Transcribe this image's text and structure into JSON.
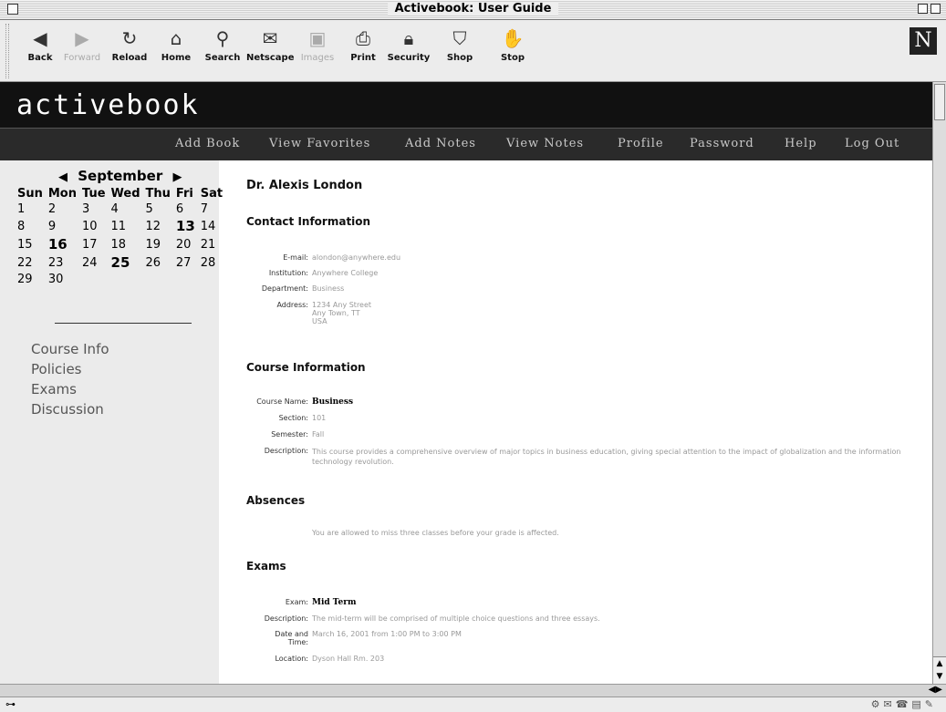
{
  "window": {
    "title": "Activebook: User Guide"
  },
  "toolbar": {
    "buttons": [
      {
        "label": "Back",
        "icon": "back-arrow-icon",
        "enabled": true
      },
      {
        "label": "Forward",
        "icon": "forward-arrow-icon",
        "enabled": false
      },
      {
        "label": "Reload",
        "icon": "reload-icon",
        "enabled": true
      },
      {
        "label": "Home",
        "icon": "home-icon",
        "enabled": true
      },
      {
        "label": "Search",
        "icon": "search-icon",
        "enabled": true
      },
      {
        "label": "Netscape",
        "icon": "netscape-icon",
        "enabled": true
      },
      {
        "label": "Images",
        "icon": "images-icon",
        "enabled": false
      },
      {
        "label": "Print",
        "icon": "print-icon",
        "enabled": true
      },
      {
        "label": "Security",
        "icon": "security-lock-icon",
        "enabled": true
      },
      {
        "label": "Shop",
        "icon": "shop-bag-icon",
        "enabled": true
      },
      {
        "label": "Stop",
        "icon": "stop-icon",
        "enabled": true
      }
    ],
    "logo_letter": "N"
  },
  "site": {
    "brand": "activebook",
    "nav": [
      "Add Book",
      "View Favorites",
      "Add Notes",
      "View Notes",
      "Profile",
      "Password",
      "Help",
      "Log Out"
    ]
  },
  "calendar": {
    "month": "September",
    "days_header": [
      "Sun",
      "Mon",
      "Tue",
      "Wed",
      "Thu",
      "Fri",
      "Sat"
    ],
    "weeks": [
      [
        "1",
        "2",
        "3",
        "4",
        "5",
        "6",
        "7"
      ],
      [
        "8",
        "9",
        "10",
        "11",
        "12",
        "13",
        "14"
      ],
      [
        "15",
        "16",
        "17",
        "18",
        "19",
        "20",
        "21"
      ],
      [
        "22",
        "23",
        "24",
        "25",
        "26",
        "27",
        "28"
      ],
      [
        "29",
        "30",
        "",
        "",
        "",
        "",
        ""
      ]
    ],
    "highlighted": [
      "13",
      "16",
      "25"
    ]
  },
  "sidebar": {
    "links": [
      "Course Info",
      "Policies",
      "Exams",
      "Discussion"
    ]
  },
  "main": {
    "name": "Dr. Alexis London",
    "contact": {
      "title": "Contact Information",
      "email_label": "E-mail:",
      "email": "alondon@anywhere.edu",
      "institution_label": "Institution:",
      "institution": "Anywhere College",
      "department_label": "Department:",
      "department": "Business",
      "address_label": "Address:",
      "address_line1": "1234 Any Street",
      "address_line2": "Any Town, TT",
      "address_line3": "USA"
    },
    "course": {
      "title": "Course Information",
      "name_label": "Course Name:",
      "name": "Business",
      "section_label": "Section:",
      "section": "101",
      "semester_label": "Semester:",
      "semester": "Fall",
      "description_label": "Description:",
      "description": "This course provides a comprehensive overview of major topics in business education, giving special attention to the impact of globalization and the information technology revolution."
    },
    "absences": {
      "title": "Absences",
      "text": "You are allowed to miss three classes before your grade is affected."
    },
    "exams": {
      "title": "Exams",
      "exam_label": "Exam:",
      "exam": "Mid Term",
      "description_label": "Description:",
      "description": "The mid-term will be comprised of multiple choice questions and three essays.",
      "datetime_label": "Date and Time:",
      "datetime": "March 16, 2001 from 1:00 PM to 3:00 PM",
      "location_label": "Location:",
      "location": "Dyson Hall Rm. 203"
    }
  }
}
